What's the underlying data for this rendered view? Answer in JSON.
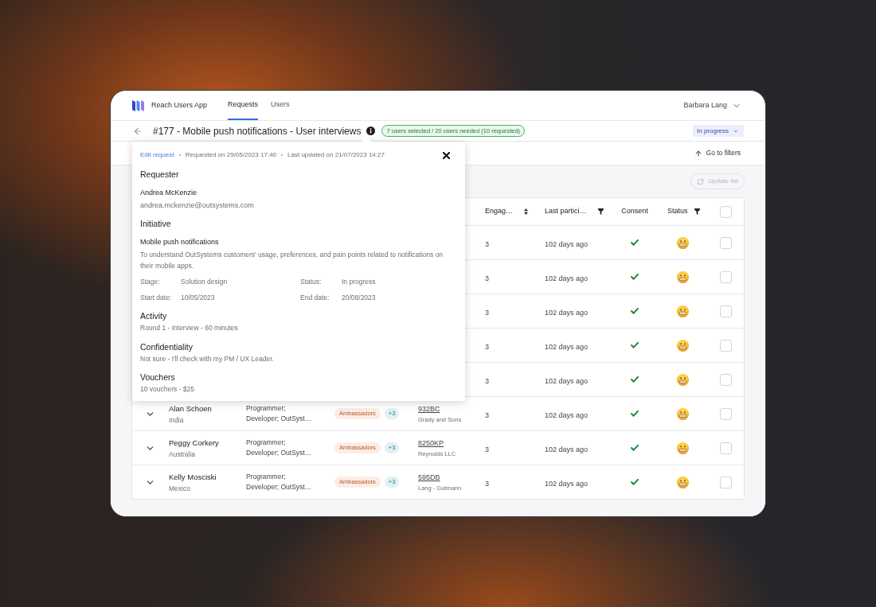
{
  "app": {
    "name": "Reach Users App",
    "nav_tabs": [
      {
        "label": "Requests",
        "selected": true
      },
      {
        "label": "Users",
        "selected": false
      }
    ],
    "user": "Barbara Lang"
  },
  "request_bar": {
    "title": "#177 - Mobile push notifications - User interviews",
    "selection_badge": "7 users selected / 20 users needed (10 requested)",
    "status_dropdown": "In progress"
  },
  "toolbar": {
    "go_to_filters": "Go to filters"
  },
  "update_button": {
    "label": "Update list",
    "disabled": true
  },
  "request_popover": {
    "edit_link": "Edit request",
    "meta": [
      "Requested on 29/05/2023 17:40",
      "Last updated on 21/07/2023 14:27"
    ],
    "requester": {
      "heading": "Requester",
      "name": "Andrea McKenzie",
      "email": "andrea.mckenzie@outsystems.com"
    },
    "initiative": {
      "heading": "Initiative",
      "name": "Mobile push notifications",
      "description": "To understand OutSystems customers' usage, preferences, and pain points related to notifications on their mobile apps.",
      "fields": [
        {
          "label": "Stage:",
          "value": "Solution design"
        },
        {
          "label": "Status:",
          "value": "In progress"
        },
        {
          "label": "Start date:",
          "value": "10/05/2023"
        },
        {
          "label": "End date:",
          "value": "20/08/2023"
        }
      ]
    },
    "details": [
      {
        "heading": "Activity",
        "text": "Round 1 - Interview - 60 minutes"
      },
      {
        "heading": "Confidentiality",
        "text": "Not sure - I'll check with my PM / UX Leader."
      },
      {
        "heading": "Vouchers",
        "text": "10 vouchers - $25"
      }
    ]
  },
  "table": {
    "columns": [
      {
        "label": "Engag…",
        "kind": "sortable"
      },
      {
        "label": "Last partici…",
        "kind": "filterable"
      },
      {
        "label": "Consent",
        "kind": "plain"
      },
      {
        "label": "Status",
        "kind": "filterable"
      }
    ],
    "select_all": {
      "checked": false
    },
    "rows": [
      {
        "engagement": "3",
        "last_participation": "102 days ago",
        "consent": true,
        "status": {
          "kind": "positive"
        },
        "selected": false
      },
      {
        "engagement": "3",
        "last_participation": "102 days ago",
        "consent": true,
        "status": {
          "kind": "positive"
        },
        "selected": false
      },
      {
        "engagement": "3",
        "last_participation": "102 days ago",
        "consent": true,
        "status": {
          "kind": "positive"
        },
        "selected": false
      },
      {
        "engagement": "3",
        "last_participation": "102 days ago",
        "consent": true,
        "status": {
          "kind": "positive"
        },
        "selected": false
      },
      {
        "engagement": "3",
        "last_participation": "102 days ago",
        "consent": true,
        "status": {
          "kind": "positive"
        },
        "selected": false
      },
      {
        "expanded": false,
        "name": "Alan Schoen",
        "country": "India",
        "roles": "Programmer; Developer; OutSyst…",
        "group_tag": "Ambassadors",
        "more_tags": "+3",
        "code": "932BC",
        "company": "Grady and Sons",
        "engagement": "3",
        "last_participation": "102 days ago",
        "consent": true,
        "status": {
          "kind": "positive"
        },
        "selected": false
      },
      {
        "expanded": false,
        "name": "Peggy Corkery",
        "country": "Australia",
        "roles": "Programmer; Developer; OutSyst…",
        "group_tag": "Ambassadors",
        "more_tags": "+3",
        "code": "8250KP",
        "company": "Reynolds LLC",
        "engagement": "3",
        "last_participation": "102 days ago",
        "consent": true,
        "status": {
          "kind": "positive"
        },
        "selected": false
      },
      {
        "expanded": false,
        "name": "Kelly Mosciski",
        "country": "Mexico",
        "roles": "Programmer; Developer; OutSyst…",
        "group_tag": "Ambassadors",
        "more_tags": "+3",
        "code": "595DB",
        "company": "Lang - Gutmann",
        "engagement": "3",
        "last_participation": "102 days ago",
        "consent": true,
        "status": {
          "kind": "positive"
        },
        "selected": false
      }
    ]
  }
}
